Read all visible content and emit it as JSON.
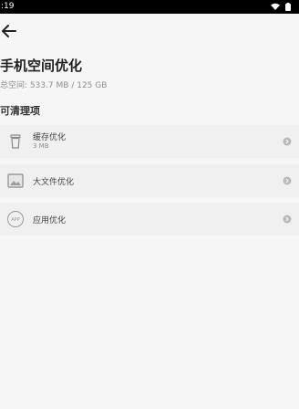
{
  "status_bar": {
    "time": ":19",
    "icons": [
      "wifi-icon",
      "battery-icon"
    ]
  },
  "header": {
    "back_icon": "arrow-left-icon"
  },
  "page": {
    "title": "手机空间优化",
    "subtitle": "总空间: 533.7 MB / 125 GB"
  },
  "section": {
    "title": "可清理项"
  },
  "items": [
    {
      "label": "缓存优化",
      "sub": "3 MB",
      "icon": "trash-icon"
    },
    {
      "label": "大文件优化",
      "sub": "",
      "icon": "image-file-icon"
    },
    {
      "label": "应用优化",
      "sub": "",
      "icon": "app-icon"
    }
  ],
  "app_icon_text": "APP",
  "colors": {
    "background": "#f6f6f6",
    "row": "#f0f0f0",
    "status_bar": "#000000"
  }
}
